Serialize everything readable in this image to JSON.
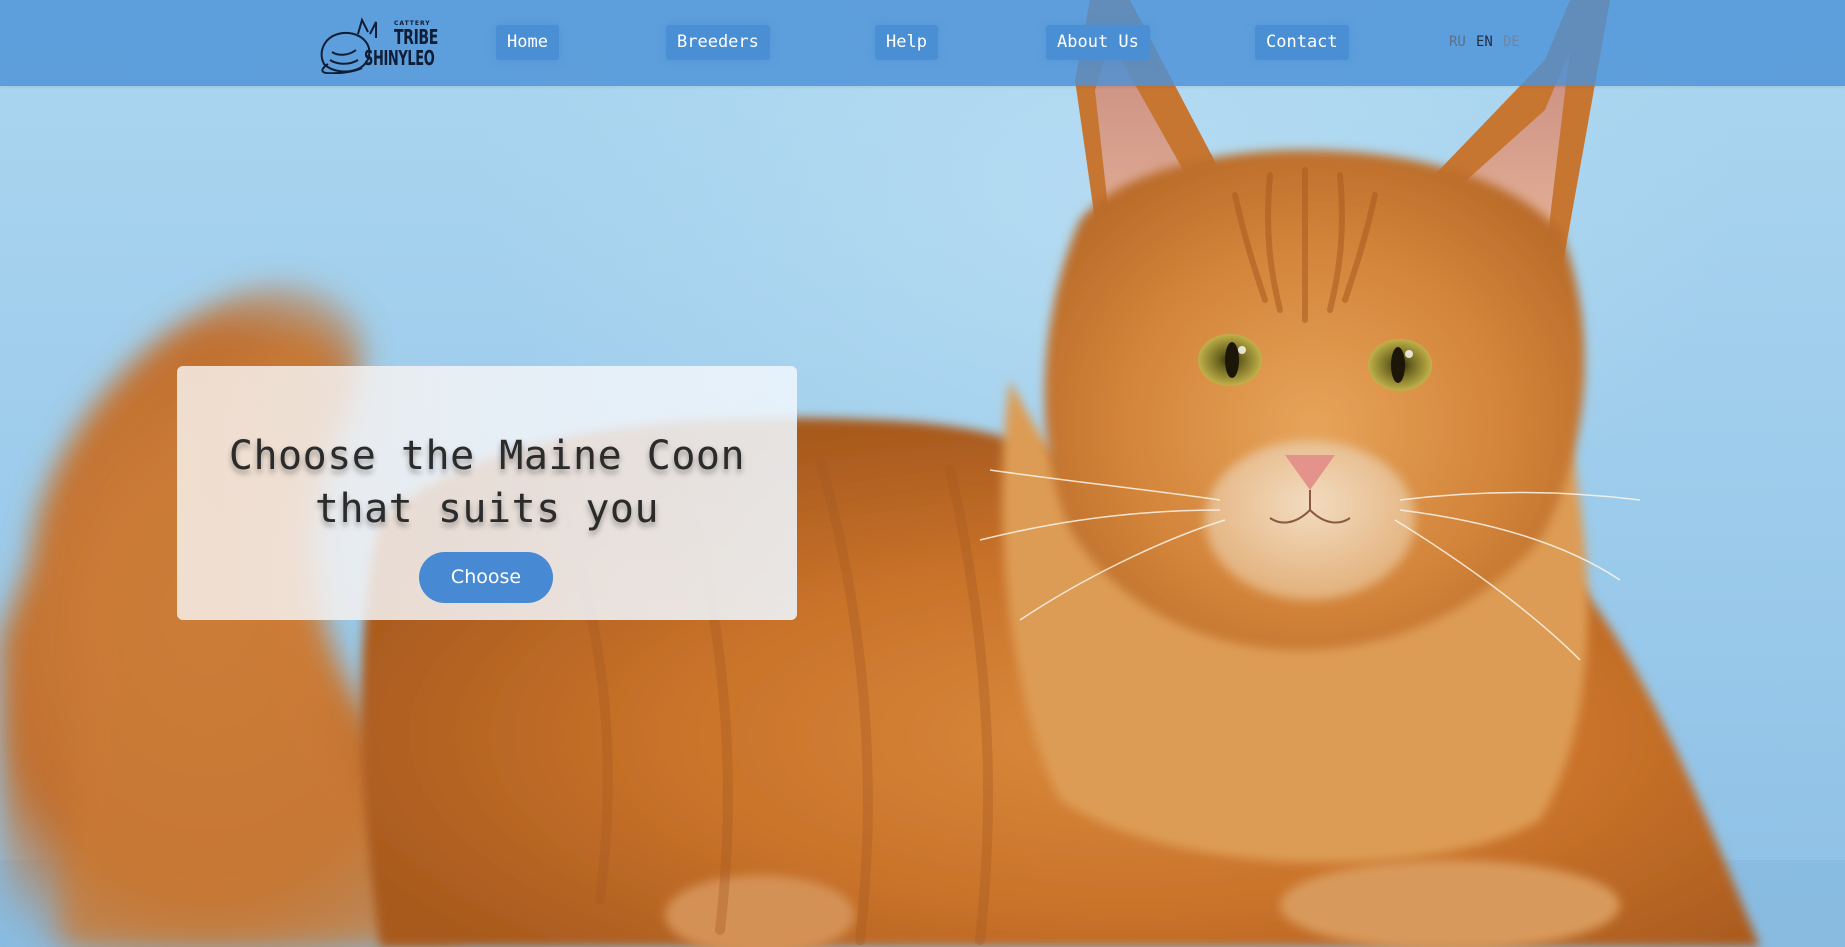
{
  "logo": {
    "small_text": "CATTERY",
    "line1": "TRIBE",
    "line2": "SHINYLEO",
    "icon": "sleeping-cat-icon"
  },
  "nav": {
    "items": [
      {
        "label": "Home"
      },
      {
        "label": "Breeders"
      },
      {
        "label": "Help"
      },
      {
        "label": "About Us"
      },
      {
        "label": "Contact"
      }
    ],
    "languages": [
      {
        "code": "RU",
        "active": false
      },
      {
        "code": "EN",
        "active": true
      },
      {
        "code": "DE",
        "active": false
      }
    ]
  },
  "hero": {
    "image": "orange-maine-coon-cat-photo",
    "title_line1": "Choose the Maine Coon",
    "title_line2": "that suits you",
    "cta_label": "Choose"
  },
  "colors": {
    "navbar": "#4c91d7",
    "button": "#4a8fd4",
    "background": "#a9d3ee",
    "cta": "#4889d3",
    "lang_active": "#1f2f45",
    "lang_inactive": "#5d7088"
  }
}
